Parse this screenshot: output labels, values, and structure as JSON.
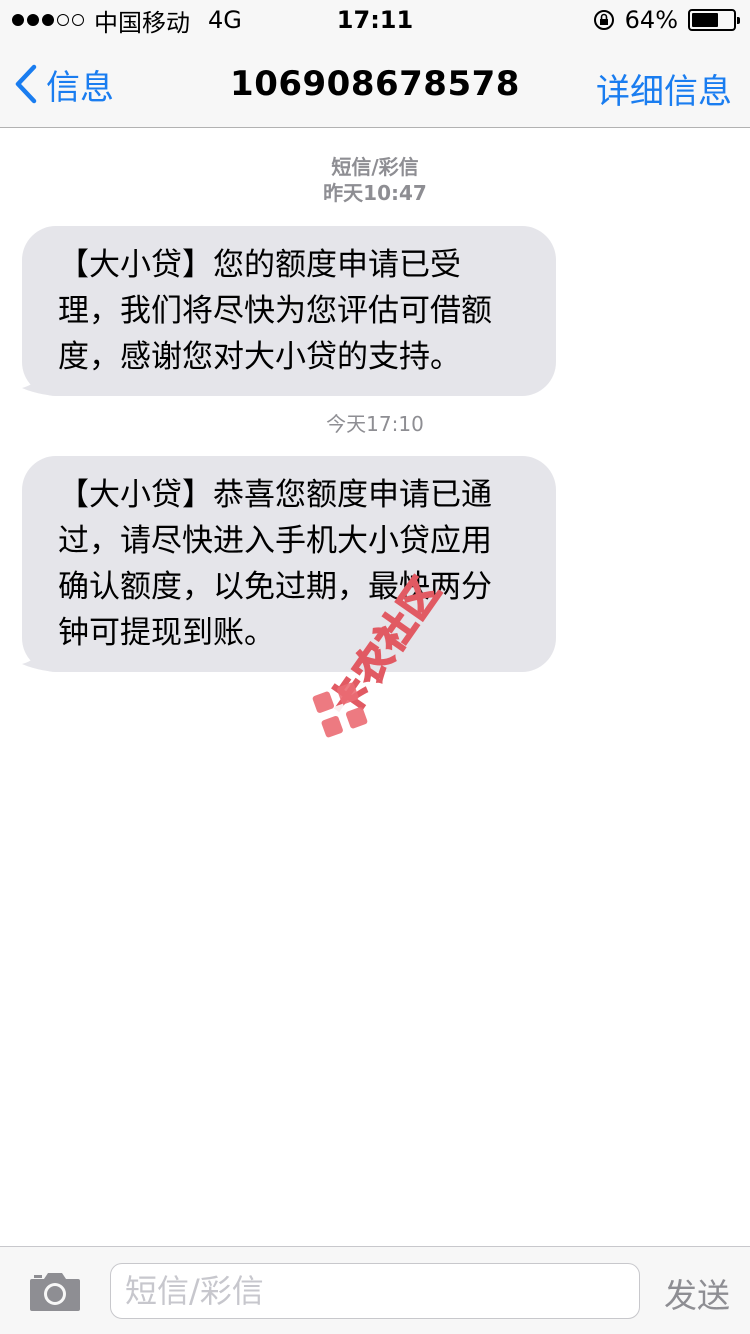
{
  "status_bar": {
    "carrier": "中国移动",
    "network": "4G",
    "time": "17:11",
    "battery": "64%",
    "battery_level": 0.64
  },
  "nav": {
    "back_label": "信息",
    "title": "106908678578",
    "details_label": "详细信息",
    "accent_color": "#1a7df0"
  },
  "messages": [
    {
      "type_label": "短信/彩信",
      "timestamp": "昨天10:47",
      "lines": [
        "【大小贷】您的额度申请已受",
        "理，我们将尽快为您评估可借额",
        "度，感谢您对大小贷的支持。"
      ]
    },
    {
      "timestamp": "今天17:10",
      "lines": [
        "【大小贷】恭喜您额度申请已通",
        "过，请尽快进入手机大小贷应用",
        "确认额度，以免过期，最快两分",
        "钟可提现到账。"
      ]
    }
  ],
  "watermark": {
    "text": "卡农社区"
  },
  "input_bar": {
    "placeholder": "短信/彩信",
    "send_label": "发送"
  }
}
